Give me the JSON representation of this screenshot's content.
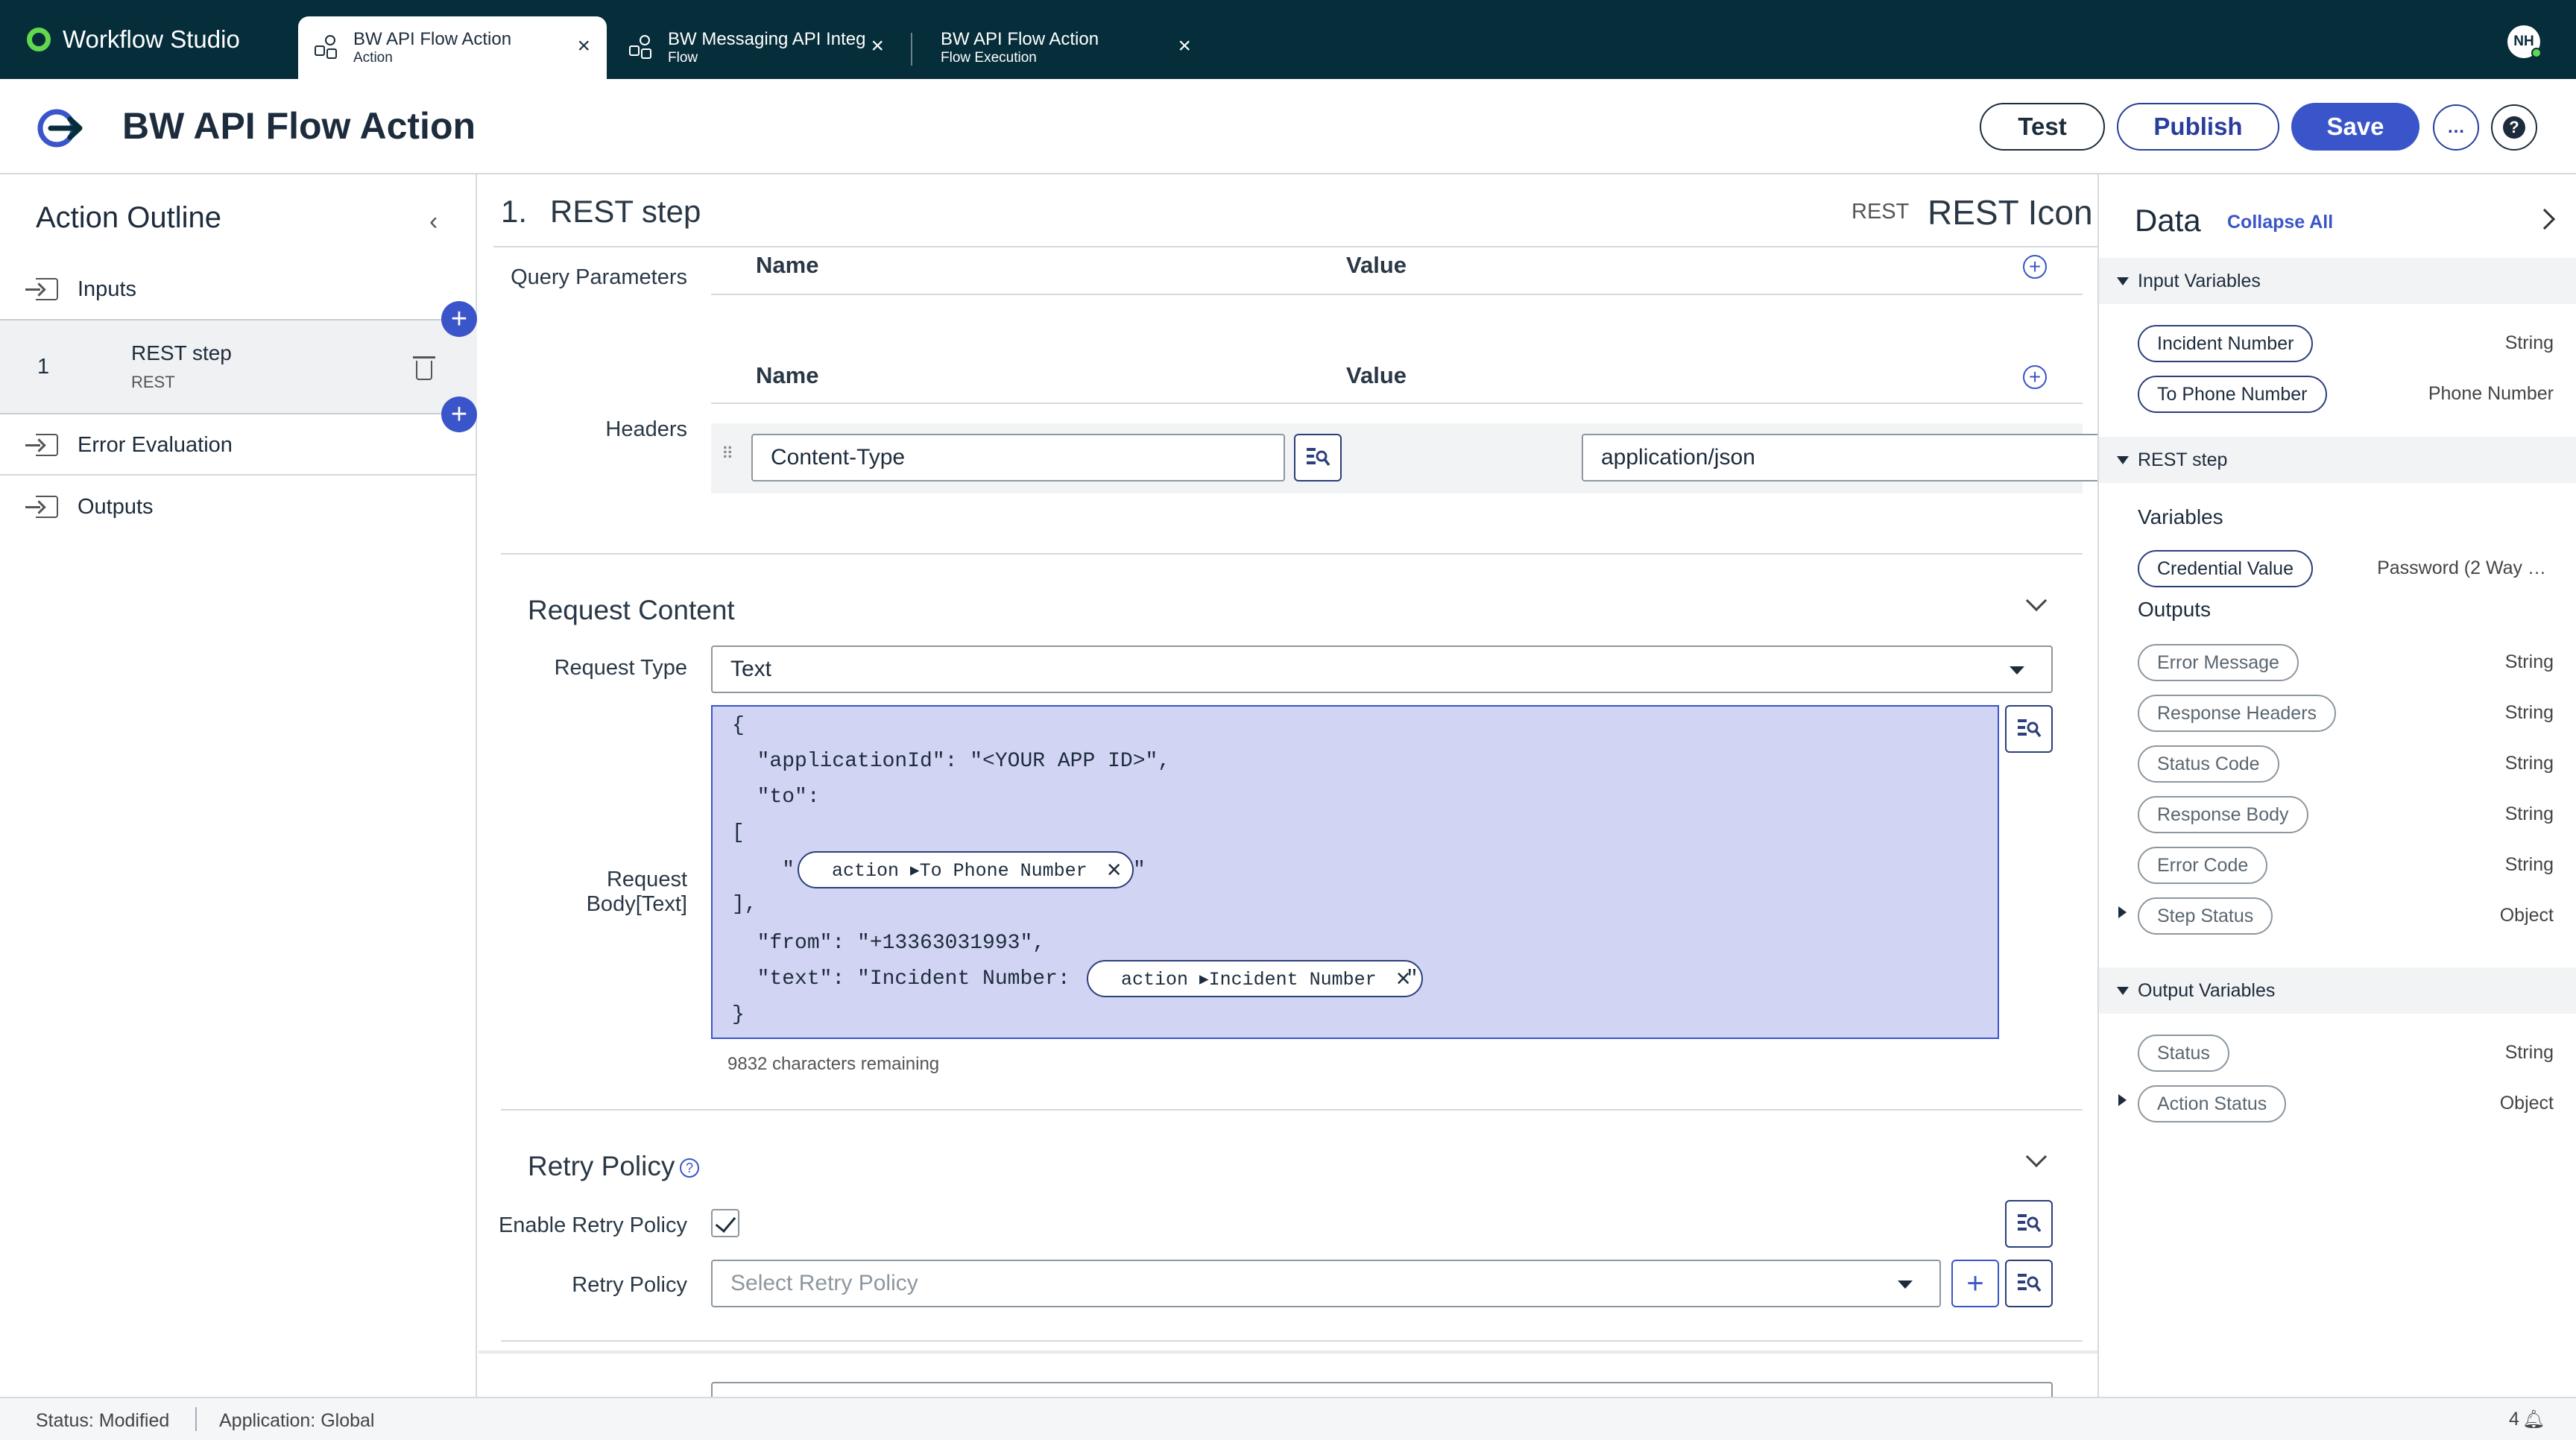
{
  "app": {
    "name": "Workflow Studio"
  },
  "tabs": [
    {
      "title": "BW API Flow Action",
      "subtitle": "Action"
    },
    {
      "title": "BW Messaging API Integ",
      "subtitle": "Flow"
    },
    {
      "title": "BW API Flow Action",
      "subtitle": "Flow Execution"
    }
  ],
  "user": {
    "initials": "NH"
  },
  "header": {
    "title": "BW API Flow Action",
    "test_label": "Test",
    "publish_label": "Publish",
    "save_label": "Save",
    "more_label": "…",
    "help_label": "?"
  },
  "outline": {
    "title": "Action Outline",
    "inputs_label": "Inputs",
    "step": {
      "number": "1",
      "name": "REST step",
      "type": "REST"
    },
    "error_label": "Error Evaluation",
    "outputs_label": "Outputs"
  },
  "step": {
    "number": "1.",
    "name": "REST step",
    "type_label": "REST",
    "icon_label": "REST Icon",
    "query_params_label": "Query Parameters",
    "headers_label": "Headers",
    "col_name": "Name",
    "col_value": "Value",
    "header_row": {
      "name": "Content-Type",
      "value": "application/json"
    },
    "request_content": {
      "title": "Request Content",
      "request_type_label": "Request Type",
      "request_type_value": "Text",
      "body_label_1": "Request",
      "body_label_2": "Body[Text]",
      "body_lines": [
        "{",
        "  \"applicationId\": \"<YOUR APP ID>\",",
        "  \"to\":",
        "[",
        "    \"",
        "],",
        "  \"from\": \"+13363031993\",",
        "  \"text\": \"Incident Number:",
        "}"
      ],
      "pill_to": "action ▸To Phone Number",
      "pill_incident": "action ▸Incident Number",
      "quote_close": "\"",
      "chars_remaining": "9832 characters remaining"
    },
    "retry": {
      "title": "Retry Policy",
      "enable_label": "Enable Retry Policy",
      "policy_label": "Retry Policy",
      "policy_placeholder": "Select Retry Policy",
      "enabled": true
    }
  },
  "data_panel": {
    "title": "Data",
    "collapse_all": "Collapse All",
    "input_variables_label": "Input Variables",
    "inputs": [
      {
        "name": "Incident Number",
        "type": "String"
      },
      {
        "name": "To Phone Number",
        "type": "Phone Number"
      }
    ],
    "rest_step_label": "REST step",
    "variables_label": "Variables",
    "variables": [
      {
        "name": "Credential Value",
        "type": "Password (2 Way …"
      }
    ],
    "outputs_label": "Outputs",
    "outputs": [
      {
        "name": "Error Message",
        "type": "String"
      },
      {
        "name": "Response Headers",
        "type": "String"
      },
      {
        "name": "Status Code",
        "type": "String"
      },
      {
        "name": "Response Body",
        "type": "String"
      },
      {
        "name": "Error Code",
        "type": "String"
      },
      {
        "name": "Step Status",
        "type": "Object"
      }
    ],
    "output_variables_label": "Output Variables",
    "output_vars": [
      {
        "name": "Status",
        "type": "String"
      },
      {
        "name": "Action Status",
        "type": "Object"
      }
    ]
  },
  "status_bar": {
    "status": "Status: Modified",
    "application": "Application: Global",
    "notifications": "4"
  },
  "colors": {
    "topbar": "#052d3a",
    "accent": "#3a55c9",
    "brand_green": "#62d84e",
    "body_highlight": "#d1d5f3"
  }
}
